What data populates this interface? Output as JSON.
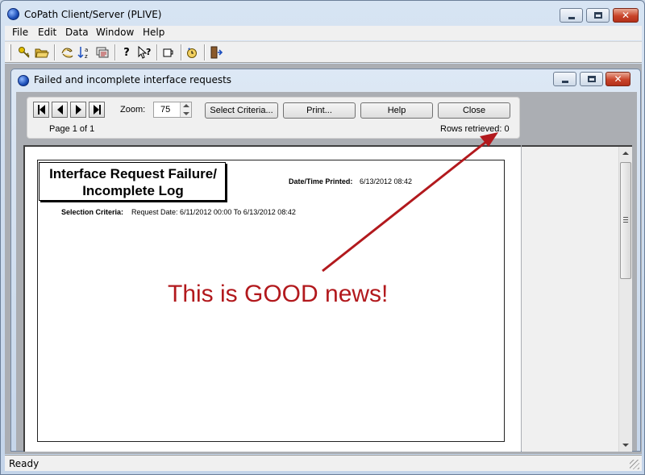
{
  "window": {
    "title": "CoPath Client/Server (PLIVE)"
  },
  "menu": [
    "File",
    "Edit",
    "Data",
    "Window",
    "Help"
  ],
  "toolbar": {
    "icons": [
      "key-icon",
      "folder-open-icon",
      "hand-icon",
      "sort-az-icon",
      "cards-icon",
      "help-icon",
      "whats-this-icon",
      "mug-icon",
      "clock-refresh-icon",
      "exit-door-icon"
    ]
  },
  "child_window": {
    "title": "Failed and incomplete interface requests"
  },
  "report_controls": {
    "zoom_label": "Zoom:",
    "zoom_value": "75",
    "page_status": "Page 1 of 1",
    "rows_retrieved": "Rows retrieved: 0",
    "buttons": {
      "select_criteria": "Select Criteria...",
      "print": "Print...",
      "help": "Help",
      "close": "Close"
    }
  },
  "report": {
    "title_line1": "Interface Request Failure/",
    "title_line2": "Incomplete Log",
    "printed_label": "Date/Time Printed:",
    "printed_value": "6/13/2012 08:42",
    "criteria_label": "Selection Criteria:",
    "criteria_value": "Request Date:  6/11/2012 00:00 To 6/13/2012 08:42"
  },
  "annotation": {
    "text": "This is GOOD news!",
    "color": "#b2191d"
  },
  "status": {
    "text": "Ready"
  }
}
